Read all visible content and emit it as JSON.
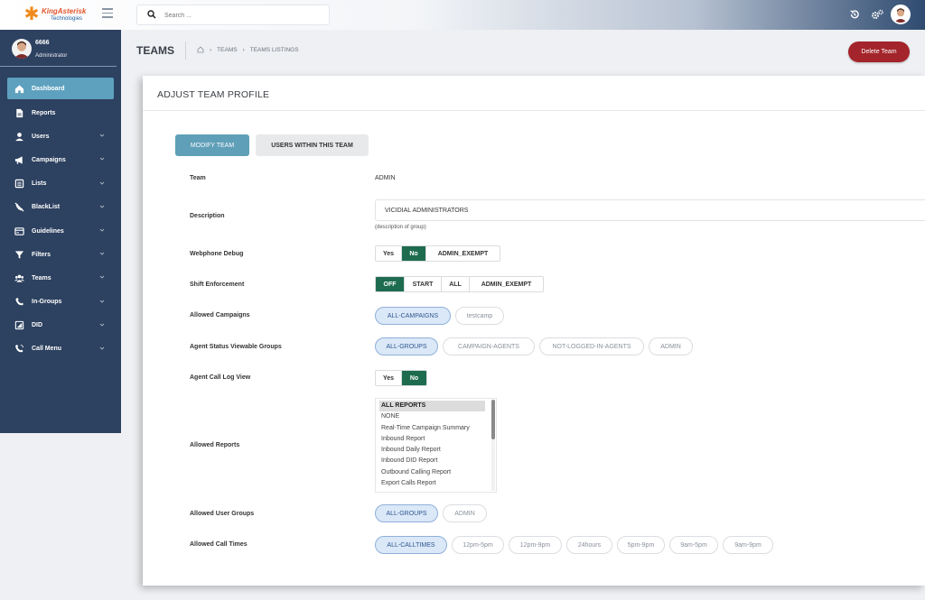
{
  "topbar": {
    "logo_text": "KingAsterisk",
    "logo_sub": "Technologies",
    "search_placeholder": "Search ..."
  },
  "sidebar": {
    "user_name": "6666",
    "user_role": "Administrator",
    "items": [
      {
        "label": "Dashboard",
        "icon": "home-icon",
        "active": true,
        "chevron": false
      },
      {
        "label": "Reports",
        "icon": "report-icon",
        "active": false,
        "chevron": false
      },
      {
        "label": "Users",
        "icon": "user-icon",
        "active": false,
        "chevron": true
      },
      {
        "label": "Campaigns",
        "icon": "megaphone-icon",
        "active": false,
        "chevron": true
      },
      {
        "label": "Lists",
        "icon": "list-icon",
        "active": false,
        "chevron": true
      },
      {
        "label": "BlackList",
        "icon": "blocked-phone-icon",
        "active": false,
        "chevron": true
      },
      {
        "label": "Guidelines",
        "icon": "card-icon",
        "active": false,
        "chevron": true
      },
      {
        "label": "Filters",
        "icon": "filter-icon",
        "active": false,
        "chevron": true
      },
      {
        "label": "Teams",
        "icon": "users-icon",
        "active": false,
        "chevron": true
      },
      {
        "label": "In-Groups",
        "icon": "phone-icon",
        "active": false,
        "chevron": true
      },
      {
        "label": "DID",
        "icon": "did-icon",
        "active": false,
        "chevron": true
      },
      {
        "label": "Call Menu",
        "icon": "call-menu-icon",
        "active": false,
        "chevron": true
      }
    ]
  },
  "header": {
    "title": "TEAMS",
    "breadcrumbs": [
      "TEAMS",
      "TEAMS LISTINGS"
    ],
    "delete_label": "Delete Team"
  },
  "panel": {
    "title": "ADJUST TEAM PROFILE",
    "tabs": [
      "MODIFY TEAM",
      "USERS WITHIN THIS TEAM"
    ]
  },
  "form": {
    "team": {
      "label": "Team",
      "value": "ADMIN"
    },
    "description": {
      "label": "Description",
      "value": "VICIDIAL ADMINISTRATORS",
      "hint": "(description of group)"
    },
    "webphone_debug": {
      "label": "Webphone Debug",
      "options": [
        "Yes",
        "No",
        "ADMIN_EXEMPT"
      ],
      "selected": "No"
    },
    "shift_enforcement": {
      "label": "Shift Enforcement",
      "options": [
        "OFF",
        "START",
        "ALL",
        "ADMIN_EXEMPT"
      ],
      "selected": "OFF"
    },
    "allowed_campaigns": {
      "label": "Allowed Campaigns",
      "options": [
        "ALL-CAMPAIGNS",
        "testcamp"
      ],
      "selected": [
        "ALL-CAMPAIGNS"
      ]
    },
    "agent_status_groups": {
      "label": "Agent Status Viewable Groups",
      "options": [
        "ALL-GROUPS",
        "CAMPAIGN-AGENTS",
        "NOT-LOGGED-IN-AGENTS",
        "ADMIN"
      ],
      "selected": [
        "ALL-GROUPS"
      ]
    },
    "agent_call_log": {
      "label": "Agent Call Log View",
      "options": [
        "Yes",
        "No"
      ],
      "selected": "No"
    },
    "allowed_reports": {
      "label": "Allowed Reports",
      "options": [
        "ALL REPORTS",
        "NONE",
        "Real-Time Campaign Summary",
        "Inbound Report",
        "Inbound Daily Report",
        "Inbound DID Report",
        "Outbound Calling Report",
        "Export Calls Report"
      ],
      "selected": "ALL REPORTS"
    },
    "allowed_user_groups": {
      "label": "Allowed User Groups",
      "options": [
        "ALL-GROUPS",
        "ADMIN"
      ],
      "selected": [
        "ALL-GROUPS"
      ]
    },
    "allowed_call_times": {
      "label": "Allowed Call Times",
      "options": [
        "ALL-CALLTIMES",
        "12pm-5pm",
        "12pm-9pm",
        "24hours",
        "5pm-9pm",
        "9am-5pm",
        "9am-9pm"
      ],
      "selected": [
        "ALL-CALLTIMES"
      ]
    }
  },
  "colors": {
    "sidebar_bg": "#2d4160",
    "active_menu": "#5ea1bf",
    "toggle_on": "#1e6c4f",
    "danger": "#a3242a",
    "pill_on": "#dbe8f8"
  }
}
